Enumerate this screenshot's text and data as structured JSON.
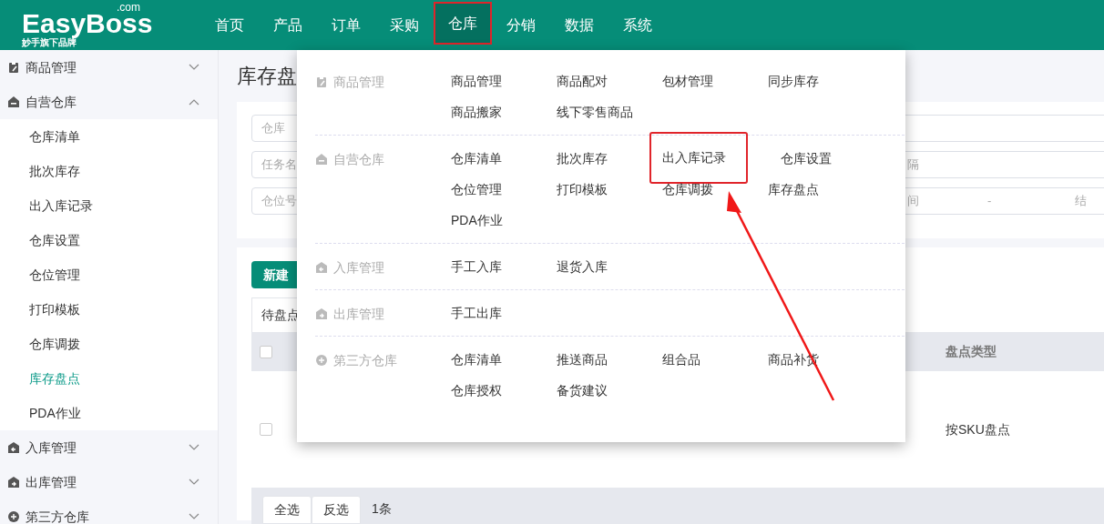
{
  "logo": {
    "name": "EasyBoss",
    "suffix": ".com",
    "tagline": "妙手旗下品牌"
  },
  "nav": [
    {
      "label": "首页",
      "selected": false,
      "highlighted": false
    },
    {
      "label": "产品",
      "selected": false,
      "highlighted": false
    },
    {
      "label": "订单",
      "selected": false,
      "highlighted": false
    },
    {
      "label": "采购",
      "selected": false,
      "highlighted": false
    },
    {
      "label": "仓库",
      "selected": true,
      "highlighted": true
    },
    {
      "label": "分销",
      "selected": false,
      "highlighted": false
    },
    {
      "label": "数据",
      "selected": false,
      "highlighted": false
    },
    {
      "label": "系统",
      "selected": false,
      "highlighted": false
    }
  ],
  "sidebar": [
    {
      "label": "商品管理",
      "expanded": false
    },
    {
      "label": "自营仓库",
      "expanded": true,
      "children": [
        {
          "label": "仓库清单",
          "selected": false
        },
        {
          "label": "批次库存",
          "selected": false
        },
        {
          "label": "出入库记录",
          "selected": false
        },
        {
          "label": "仓库设置",
          "selected": false
        },
        {
          "label": "仓位管理",
          "selected": false
        },
        {
          "label": "打印模板",
          "selected": false
        },
        {
          "label": "仓库调拨",
          "selected": false
        },
        {
          "label": "库存盘点",
          "selected": true
        },
        {
          "label": "PDA作业",
          "selected": false
        }
      ]
    },
    {
      "label": "入库管理",
      "expanded": false
    },
    {
      "label": "出库管理",
      "expanded": false
    },
    {
      "label": "第三方仓库",
      "expanded": false
    }
  ],
  "page_title": "库存盘",
  "filters": {
    "rows": [
      {
        "placeholder": "仓库"
      },
      {
        "placeholder": "任务名",
        "right_placeholder": "隔"
      },
      {
        "placeholder": "仓位号",
        "range": [
          "间",
          "-",
          "结"
        ]
      }
    ]
  },
  "table": {
    "new_button": "新建",
    "tab": "待盘点",
    "header": {
      "checked": false,
      "column_3": "盘点类型"
    },
    "rows": [
      {
        "checked": false,
        "column_3": "按SKU盘点"
      }
    ],
    "footer": {
      "buttons": [
        "全选",
        "反选"
      ],
      "count": "1条"
    }
  },
  "mega_menu": [
    {
      "label": "商品管理",
      "items": [
        {
          "label": "商品管理",
          "highlighted": false
        },
        {
          "label": "商品配对",
          "highlighted": false
        },
        {
          "label": "包材管理",
          "highlighted": false
        },
        {
          "label": "同步库存",
          "highlighted": false
        },
        {
          "label": "商品搬家",
          "highlighted": false
        },
        {
          "label": "线下零售商品",
          "highlighted": false
        }
      ]
    },
    {
      "label": "自营仓库",
      "items": [
        {
          "label": "仓库清单",
          "highlighted": false
        },
        {
          "label": "批次库存",
          "highlighted": false
        },
        {
          "label": "出入库记录",
          "highlighted": true
        },
        {
          "label": "仓库设置",
          "highlighted": false
        },
        {
          "label": "仓位管理",
          "highlighted": false
        },
        {
          "label": "打印模板",
          "highlighted": false
        },
        {
          "label": "仓库调拨",
          "highlighted": false
        },
        {
          "label": "库存盘点",
          "highlighted": false
        },
        {
          "label": "PDA作业",
          "highlighted": false
        }
      ]
    },
    {
      "label": "入库管理",
      "items": [
        {
          "label": "手工入库",
          "highlighted": false
        },
        {
          "label": "退货入库",
          "highlighted": false
        }
      ]
    },
    {
      "label": "出库管理",
      "items": [
        {
          "label": "手工出库",
          "highlighted": false
        }
      ]
    },
    {
      "label": "第三方仓库",
      "items": [
        {
          "label": "仓库清单",
          "highlighted": false
        },
        {
          "label": "推送商品",
          "highlighted": false
        },
        {
          "label": "组合品",
          "highlighted": false
        },
        {
          "label": "商品补货",
          "highlighted": false
        },
        {
          "label": "仓库授权",
          "highlighted": false
        },
        {
          "label": "备货建议",
          "highlighted": false
        }
      ]
    }
  ]
}
